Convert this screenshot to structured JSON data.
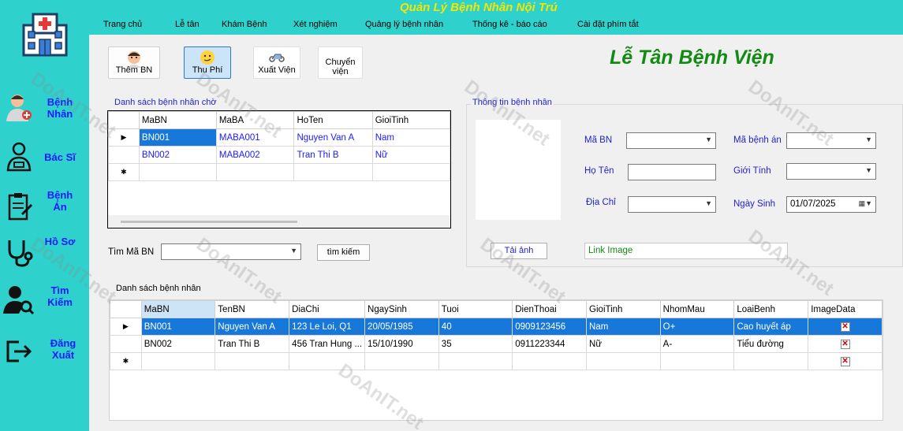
{
  "app": {
    "title": "Quản Lý Bệnh Nhân Nội Trú"
  },
  "menu": [
    {
      "label": "Trang chủ"
    },
    {
      "label": "Lễ tân"
    },
    {
      "label": "Khám Bệnh"
    },
    {
      "label": "Xét nghiệm"
    },
    {
      "label": "Quảng lý bệnh nhân"
    },
    {
      "label": "Thống kê - báo cáo"
    },
    {
      "label": "Cài đặt phím tắt"
    }
  ],
  "sidebar": {
    "items": [
      {
        "label": "Bệnh Nhân",
        "icon": "patient-icon"
      },
      {
        "label": "Bác Sĩ",
        "icon": "doctor-icon"
      },
      {
        "label": "Bệnh Án",
        "icon": "clipboard-icon"
      },
      {
        "label": "Hồ Sơ",
        "icon": "stethoscope-icon"
      },
      {
        "label": "Tìm Kiếm",
        "icon": "user-search-icon"
      },
      {
        "label": "Đăng Xuất",
        "icon": "logout-icon"
      }
    ]
  },
  "toolbar": {
    "add_patient": "Thêm BN",
    "collect_fee": "Thu Phí",
    "discharge": "Xuất Viện",
    "transfer": "Chuyển viện"
  },
  "page_heading": "Lễ Tân Bệnh Viện",
  "waiting_list": {
    "title": "Danh sách bệnh nhân chờ",
    "columns": [
      "MaBN",
      "MaBA",
      "HoTen",
      "GioiTinh"
    ],
    "rows": [
      [
        "BN001",
        "MABA001",
        "Nguyen Van A",
        "Nam"
      ],
      [
        "BN002",
        "MABA002",
        "Tran Thi B",
        "Nữ"
      ]
    ]
  },
  "search": {
    "label": "Tìm Mã BN",
    "value": "",
    "button": "tìm kiếm"
  },
  "patient_info": {
    "title": "Thông tin bệnh nhân",
    "patient_id_label": "Mã BN",
    "patient_id_value": "",
    "record_id_label": "Mã bệnh án",
    "record_id_value": "",
    "name_label": "Họ Tên",
    "name_value": "",
    "gender_label": "Giới Tính",
    "gender_value": "",
    "address_label": "Địa Chỉ",
    "address_value": "",
    "dob_label": "Ngày Sinh",
    "dob_value": "01/07/2025",
    "upload_button": "Tải ảnh",
    "image_link": "Link Image"
  },
  "patients": {
    "title": "Danh sách bệnh nhân",
    "columns": [
      "MaBN",
      "TenBN",
      "DiaChi",
      "NgaySinh",
      "Tuoi",
      "DienThoai",
      "GioiTinh",
      "NhomMau",
      "LoaiBenh",
      "ImageData"
    ],
    "rows": [
      [
        "BN001",
        "Nguyen Van A",
        "123 Le Loi, Q1",
        "20/05/1985",
        "40",
        "0909123456",
        "Nam",
        "O+",
        "Cao huyết áp",
        ""
      ],
      [
        "BN002",
        "Tran Thi B",
        "456 Tran Hung ...",
        "15/10/1990",
        "35",
        "0911223344",
        "Nữ",
        "A-",
        "Tiểu đường",
        ""
      ]
    ]
  },
  "watermark": "DoAnIT.net"
}
